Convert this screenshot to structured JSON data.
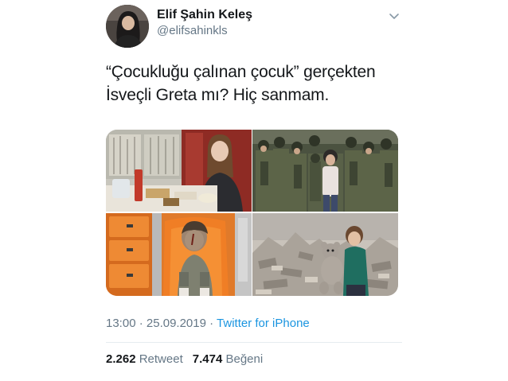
{
  "author": {
    "display_name": "Elif Şahin Keleş",
    "handle": "@elifsahinkls"
  },
  "tweet": {
    "text": "“Çocukluğu çalınan çocuk” gerçekten\nİsveçli Greta mı? Hiç sanmam."
  },
  "media": [
    {
      "icon": "photo-girl-train-table"
    },
    {
      "icon": "photo-soldiers-child"
    },
    {
      "icon": "photo-injured-boy-ambulance"
    },
    {
      "icon": "photo-girl-teddy-rubble"
    }
  ],
  "meta": {
    "time": "13:00",
    "separator": " · ",
    "date": "25.09.2019",
    "source": "Twitter for iPhone"
  },
  "stats": {
    "retweet_count": "2.262",
    "retweet_label": "Retweet",
    "like_count": "7.474",
    "like_label": "Beğeni"
  },
  "colors": {
    "text": "#14171a",
    "secondary": "#657786",
    "link": "#1b95e0",
    "divider": "#e6ecf0"
  }
}
